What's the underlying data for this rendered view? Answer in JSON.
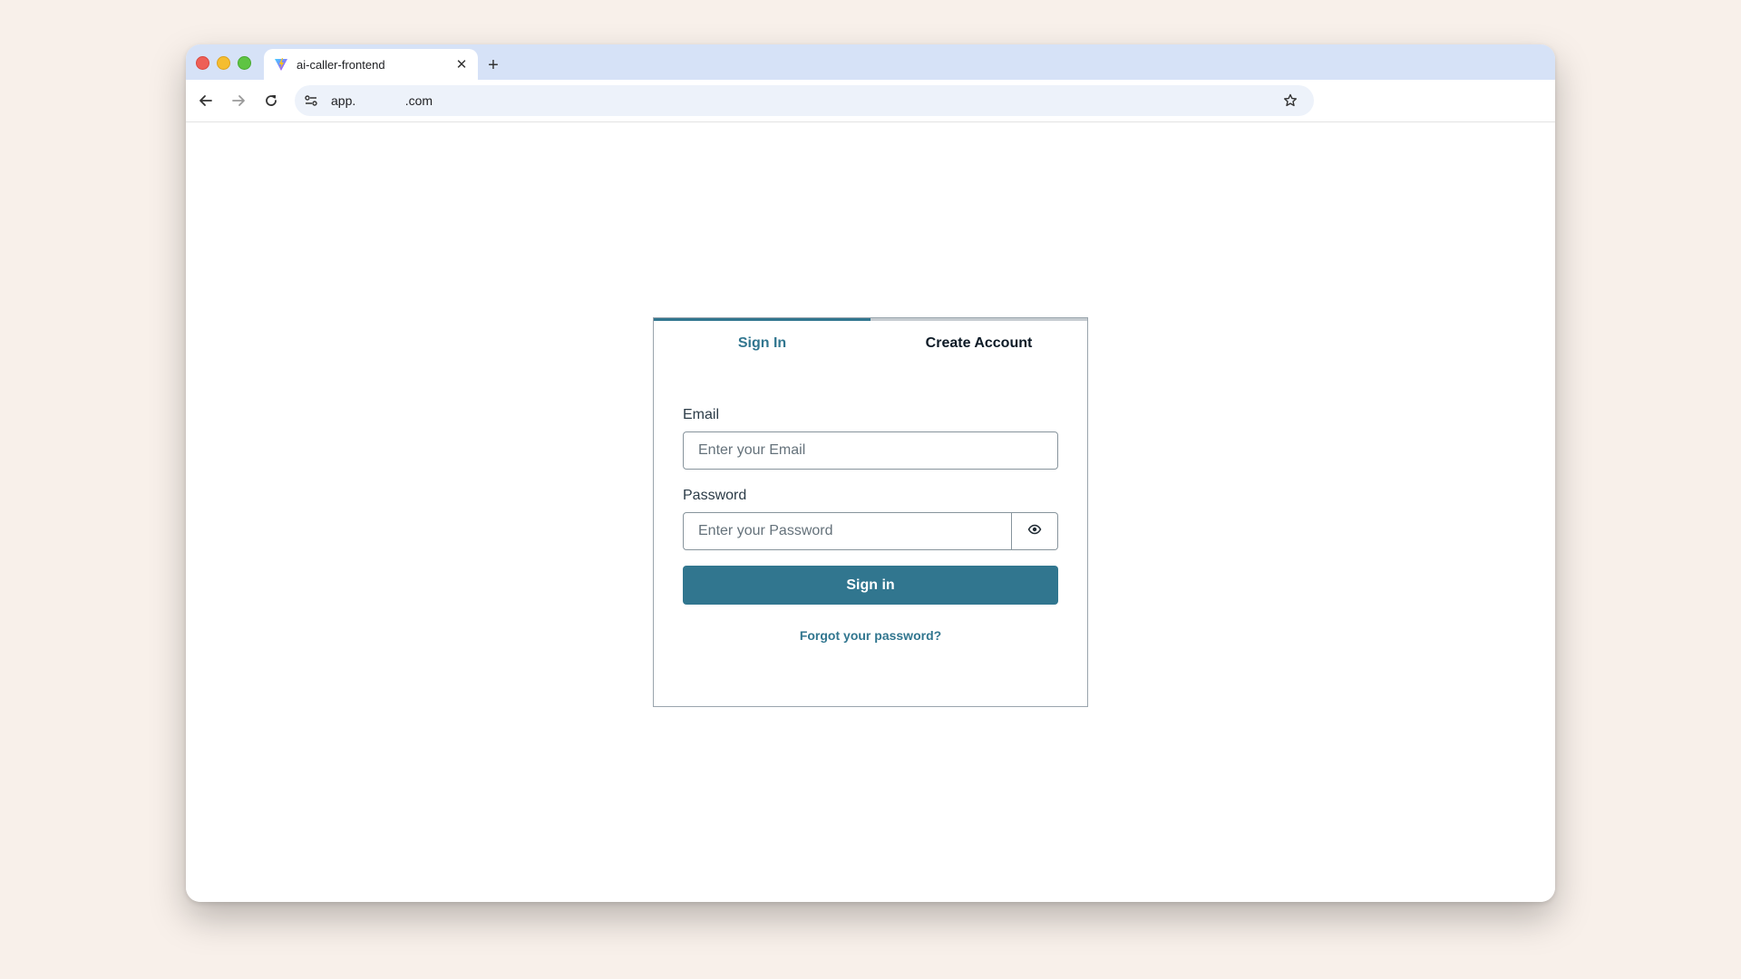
{
  "browser": {
    "tab_title": "ai-caller-frontend",
    "tab_close": "✕",
    "new_tab": "+",
    "url": "app.              .com"
  },
  "auth": {
    "tabs": [
      {
        "label": "Sign In",
        "active": true
      },
      {
        "label": "Create Account",
        "active": false
      }
    ],
    "email_label": "Email",
    "email_placeholder": "Enter your Email",
    "email_value": "",
    "password_label": "Password",
    "password_placeholder": "Enter your Password",
    "password_value": "",
    "submit_label": "Sign in",
    "forgot_label": "Forgot your password?"
  },
  "colors": {
    "accent": "#31768f",
    "page_background": "#f8f0ea",
    "tab_strip": "#d6e2f7"
  },
  "icons": [
    "vite-favicon-icon",
    "close-icon",
    "plus-icon",
    "back-arrow-icon",
    "forward-arrow-icon",
    "reload-icon",
    "site-info-icon",
    "star-icon",
    "eye-icon"
  ]
}
